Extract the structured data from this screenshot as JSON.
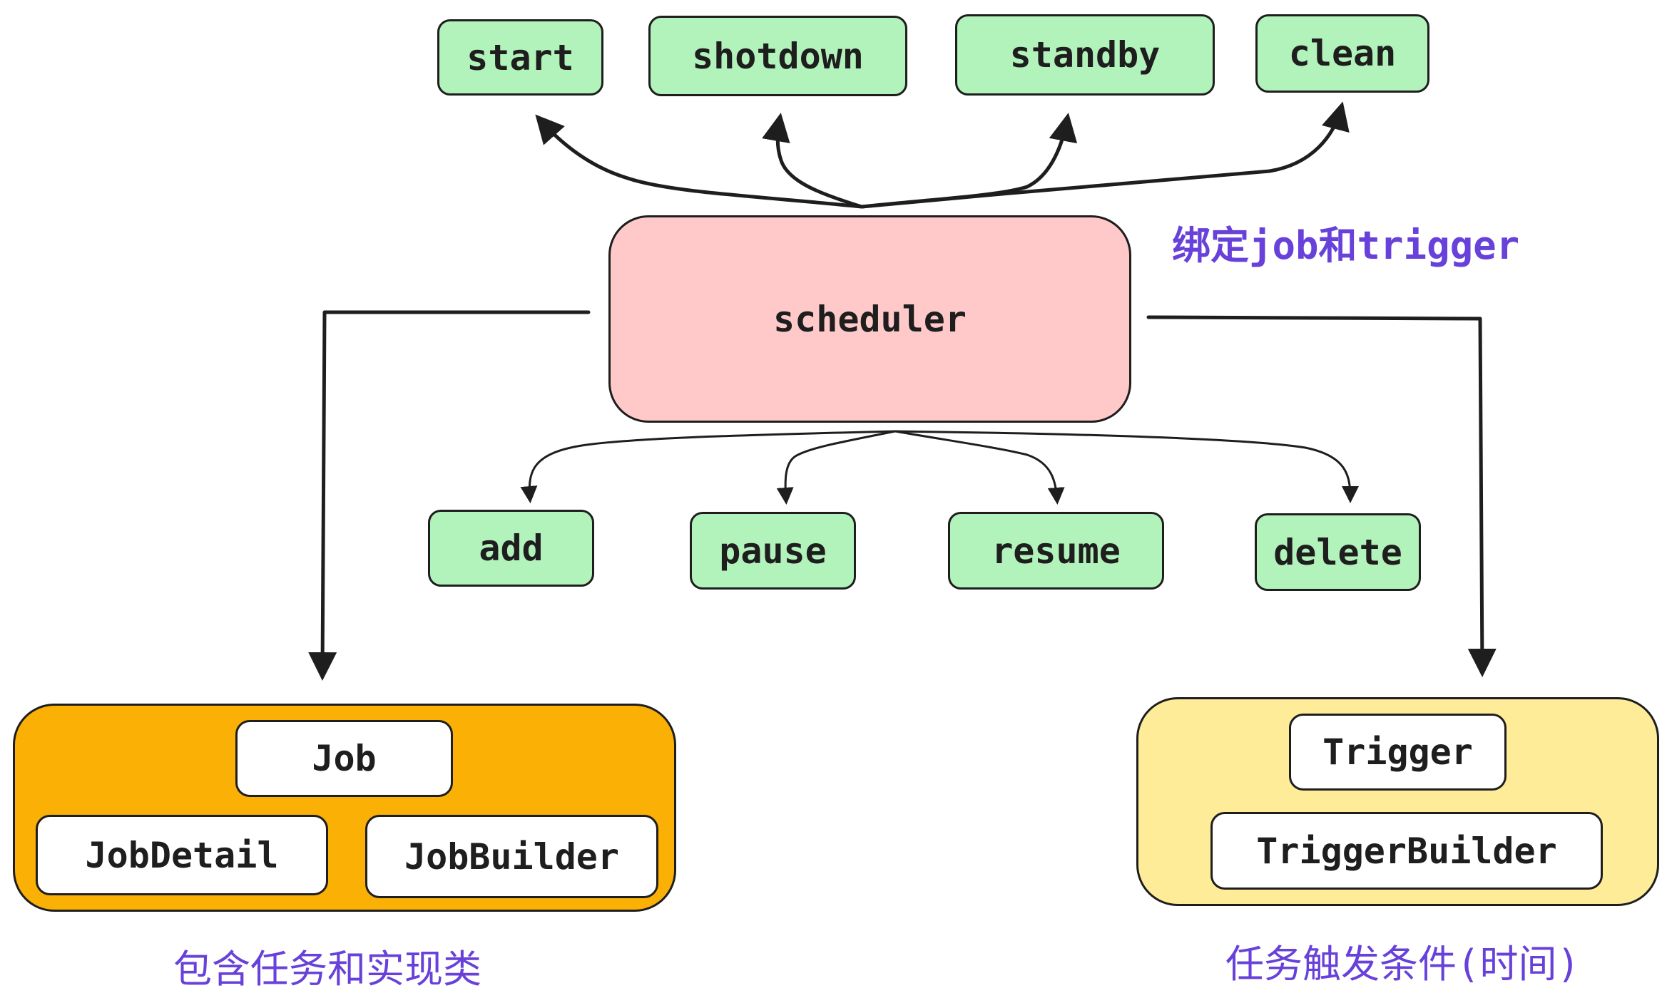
{
  "colors": {
    "operation_fill": "#b2f2bb",
    "scheduler_fill": "#ffc9c9",
    "job_group_fill": "#fab005",
    "trigger_group_fill": "#ffec99",
    "note_text": "#6741d9",
    "stroke": "#1e1e1e"
  },
  "scheduler": {
    "label": "scheduler"
  },
  "lifecycle": [
    {
      "label": "start"
    },
    {
      "label": "shotdown"
    },
    {
      "label": "standby"
    },
    {
      "label": "clean"
    }
  ],
  "operations": [
    {
      "label": "add"
    },
    {
      "label": "pause"
    },
    {
      "label": "resume"
    },
    {
      "label": "delete"
    }
  ],
  "job_group": {
    "items": [
      {
        "label": "Job"
      },
      {
        "label": "JobDetail"
      },
      {
        "label": "JobBuilder"
      }
    ],
    "caption": "包含任务和实现类"
  },
  "trigger_group": {
    "items": [
      {
        "label": "Trigger"
      },
      {
        "label": "TriggerBuilder"
      }
    ],
    "caption": "任务触发条件(时间)"
  },
  "binding_note": "绑定job和trigger"
}
